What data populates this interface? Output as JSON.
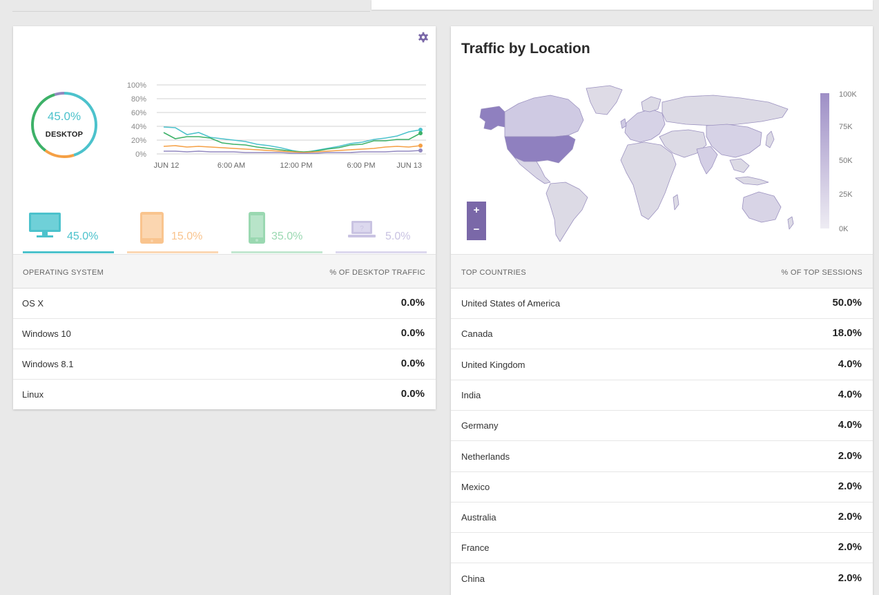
{
  "colors": {
    "desktop": "#4cc2cc",
    "tablet": "#f5a045",
    "mobile": "#3db168",
    "other": "#9389c0",
    "accent": "#7a68a8"
  },
  "device_card": {
    "settings_icon": "gear-icon",
    "donut": {
      "percent": "45.0%",
      "label": "DESKTOP"
    },
    "devices": [
      {
        "name": "desktop",
        "icon": "monitor-icon",
        "percent": "45.0%"
      },
      {
        "name": "tablet",
        "icon": "tablet-icon",
        "percent": "15.0%"
      },
      {
        "name": "mobile",
        "icon": "phone-icon",
        "percent": "35.0%"
      },
      {
        "name": "other",
        "icon": "unknown-laptop-icon",
        "percent": "5.0%"
      }
    ],
    "table": {
      "col1": "OPERATING SYSTEM",
      "col2": "% OF DESKTOP TRAFFIC",
      "rows": [
        {
          "name": "OS X",
          "value": "0.0%"
        },
        {
          "name": "Windows 10",
          "value": "0.0%"
        },
        {
          "name": "Windows 8.1",
          "value": "0.0%"
        },
        {
          "name": "Linux",
          "value": "0.0%"
        }
      ]
    }
  },
  "chart_data": {
    "type": "line",
    "x_labels": [
      "JUN 12",
      "6:00 AM",
      "12:00 PM",
      "6:00 PM",
      "JUN 13"
    ],
    "y_ticks": [
      "0%",
      "20%",
      "40%",
      "60%",
      "80%",
      "100%"
    ],
    "ylim": [
      0,
      100
    ],
    "grid": true,
    "series": [
      {
        "color": "#4cc2cc",
        "values": [
          39,
          38,
          28,
          31,
          24,
          22,
          20,
          18,
          14,
          12,
          9,
          5,
          2,
          5,
          8,
          11,
          15,
          17,
          21,
          23,
          26,
          32,
          35
        ]
      },
      {
        "color": "#3db168",
        "values": [
          31,
          22,
          25,
          25,
          23,
          16,
          14,
          13,
          10,
          8,
          6,
          4,
          3,
          4,
          7,
          9,
          13,
          14,
          19,
          19,
          21,
          21,
          30
        ]
      },
      {
        "color": "#f5a045",
        "values": [
          11,
          12,
          10,
          11,
          10,
          9,
          8,
          7,
          6,
          5,
          4,
          3,
          2,
          3,
          4,
          5,
          6,
          7,
          8,
          10,
          11,
          10,
          12
        ]
      },
      {
        "color": "#9389c0",
        "values": [
          4,
          4,
          3,
          4,
          3,
          3,
          3,
          2,
          2,
          2,
          2,
          1,
          1,
          1,
          2,
          2,
          2,
          3,
          3,
          3,
          4,
          4,
          5
        ]
      }
    ]
  },
  "location_card": {
    "title": "Traffic by Location",
    "legend_ticks": [
      "100K",
      "75K",
      "50K",
      "25K",
      "0K"
    ],
    "zoom_in": "+",
    "zoom_out": "−",
    "table": {
      "col1": "TOP COUNTRIES",
      "col2": "% OF TOP SESSIONS",
      "rows": [
        {
          "name": "United States of America",
          "value": "50.0%"
        },
        {
          "name": "Canada",
          "value": "18.0%"
        },
        {
          "name": "United Kingdom",
          "value": "4.0%"
        },
        {
          "name": "India",
          "value": "4.0%"
        },
        {
          "name": "Germany",
          "value": "4.0%"
        },
        {
          "name": "Netherlands",
          "value": "2.0%"
        },
        {
          "name": "Mexico",
          "value": "2.0%"
        },
        {
          "name": "Australia",
          "value": "2.0%"
        },
        {
          "name": "France",
          "value": "2.0%"
        },
        {
          "name": "China",
          "value": "2.0%"
        }
      ]
    }
  }
}
